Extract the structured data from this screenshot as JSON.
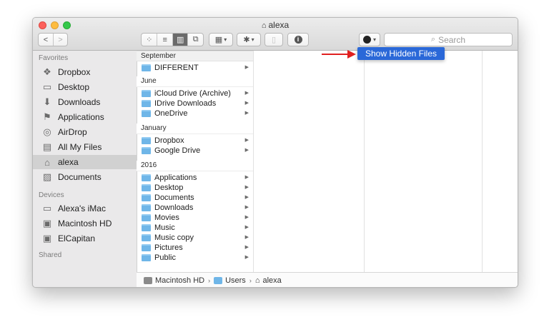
{
  "window": {
    "title": "alexa"
  },
  "toolbar": {
    "back": "<",
    "forward": ">",
    "view_icon": "▦ ≡ ▥ ⧉",
    "group": "▤ ⌄",
    "action": "✱ ⌄",
    "trash": "🗑",
    "info": "ⓘ",
    "tag": "● ⌄",
    "search_placeholder": "Search"
  },
  "sidebar": {
    "favorites_label": "Favorites",
    "favorites": [
      {
        "label": "Dropbox",
        "icon": "dropbox-icon",
        "glyph": "❖"
      },
      {
        "label": "Desktop",
        "icon": "desktop-icon",
        "glyph": "▭"
      },
      {
        "label": "Downloads",
        "icon": "downloads-icon",
        "glyph": "⬇"
      },
      {
        "label": "Applications",
        "icon": "applications-icon",
        "glyph": "⚑"
      },
      {
        "label": "AirDrop",
        "icon": "airdrop-icon",
        "glyph": "◎"
      },
      {
        "label": "All My Files",
        "icon": "all-files-icon",
        "glyph": "▤"
      },
      {
        "label": "alexa",
        "icon": "home-icon",
        "glyph": "⌂"
      },
      {
        "label": "Documents",
        "icon": "documents-icon",
        "glyph": "▨"
      }
    ],
    "devices_label": "Devices",
    "devices": [
      {
        "label": "Alexa's iMac",
        "icon": "imac-icon",
        "glyph": "▭"
      },
      {
        "label": "Macintosh HD",
        "icon": "disk-icon",
        "glyph": "▣"
      },
      {
        "label": "ElCapitan",
        "icon": "disk-icon",
        "glyph": "▣"
      }
    ],
    "shared_label": "Shared"
  },
  "column": {
    "groups": [
      {
        "header": "September",
        "items": [
          "DIFFERENT"
        ]
      },
      {
        "header": "June",
        "items": [
          "iCloud Drive (Archive)",
          "IDrive Downloads",
          "OneDrive"
        ]
      },
      {
        "header": "January",
        "items": [
          "Dropbox",
          "Google Drive"
        ]
      },
      {
        "header": "2016",
        "items": [
          "Applications",
          "Desktop",
          "Documents",
          "Downloads",
          "Movies",
          "Music",
          "Music copy",
          "Pictures",
          "Public"
        ]
      }
    ]
  },
  "statusbar": {
    "path": [
      "Macintosh HD",
      "Users",
      "alexa"
    ]
  },
  "popup": {
    "label": "Show Hidden Files"
  },
  "colors": {
    "accent": "#2a68d8",
    "arrow": "#e02020",
    "folder": "#6fb6e8"
  }
}
